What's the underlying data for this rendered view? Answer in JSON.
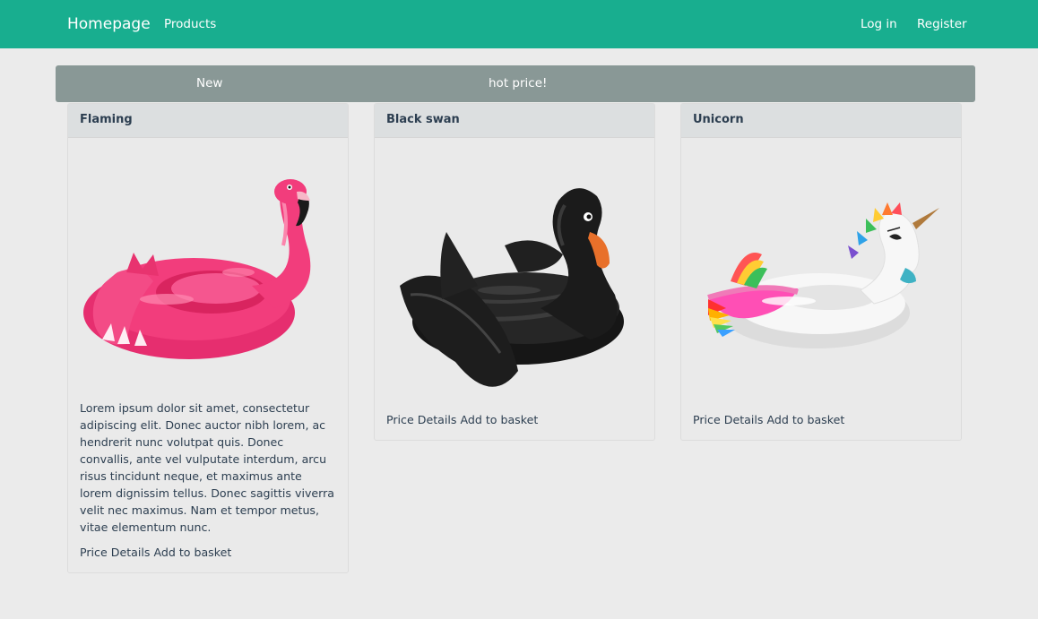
{
  "navbar": {
    "brand": "Homepage",
    "products": "Products",
    "login": "Log in",
    "register": "Register"
  },
  "banner": {
    "left_text": "New",
    "right_text": "hot price!"
  },
  "products": [
    {
      "title": "Flaming",
      "image_icon": "pink-flamingo-float",
      "description": "Lorem ipsum dolor sit amet, consectetur adipiscing elit. Donec auctor nibh lorem, ac hendrerit nunc volutpat quis. Donec convallis, ante vel vulputate interdum, arcu risus tincidunt neque, et maximus ante lorem dignissim tellus. Donec sagittis viverra velit nec maximus. Nam et tempor metus, vitae elementum nunc.",
      "price": "Price",
      "details": "Details",
      "basket": "Add to basket"
    },
    {
      "title": "Black swan",
      "image_icon": "black-swan-float",
      "price": "Price",
      "details": "Details",
      "basket": "Add to basket"
    },
    {
      "title": "Unicorn",
      "image_icon": "unicorn-float",
      "price": "Price",
      "details": "Details",
      "basket": "Add to basket"
    }
  ],
  "colors": {
    "navbar": "#18ae8f",
    "banner": "#899896",
    "background": "#ebebeb",
    "flamingo": "#f23d7c",
    "swan": "#1f1f1f"
  }
}
